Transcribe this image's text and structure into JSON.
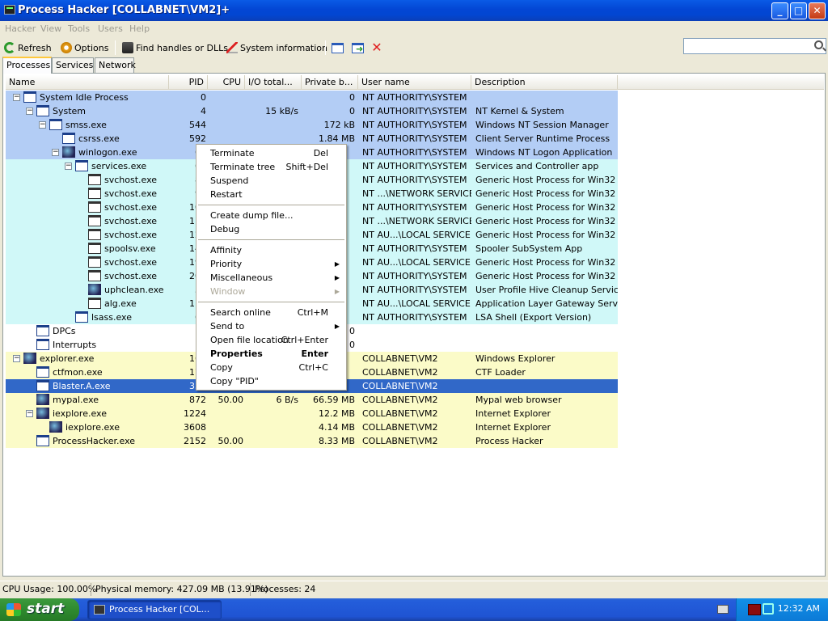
{
  "window": {
    "title": "Process Hacker [COLLABNET\\VM2]+",
    "minimize": "_",
    "maximize": "□",
    "close": "✕"
  },
  "menu": [
    "Hacker",
    "View",
    "Tools",
    "Users",
    "Help"
  ],
  "toolbar": {
    "refresh": "Refresh",
    "options": "Options",
    "find": "Find handles or DLLs",
    "sysinfo": "System information"
  },
  "tabs": [
    "Processes",
    "Services",
    "Network"
  ],
  "columns": [
    "Name",
    "PID",
    "CPU",
    "I/O total...",
    "Private b...",
    "User name",
    "Description"
  ],
  "colors": {
    "system": "#b3cdf5",
    "service": "#d0f8f8",
    "user": "#fbfbc8",
    "selected": "#3168c8",
    "none": "#ffffff"
  },
  "rows": [
    {
      "name": "System Idle Process",
      "pid": "0",
      "cpu": "",
      "io": "",
      "priv": "0",
      "user": "NT AUTHORITY\\SYSTEM",
      "desc": "",
      "depth": 0,
      "exp": "−",
      "color": "system"
    },
    {
      "name": "System",
      "pid": "4",
      "cpu": "",
      "io": "15 kB/s",
      "priv": "0",
      "user": "NT AUTHORITY\\SYSTEM",
      "desc": "NT Kernel & System",
      "depth": 1,
      "exp": "−",
      "color": "system"
    },
    {
      "name": "smss.exe",
      "pid": "544",
      "cpu": "",
      "io": "",
      "priv": "172 kB",
      "user": "NT AUTHORITY\\SYSTEM",
      "desc": "Windows NT Session Manager",
      "depth": 2,
      "exp": "−",
      "color": "system"
    },
    {
      "name": "csrss.exe",
      "pid": "592",
      "cpu": "",
      "io": "",
      "priv": "1.84 MB",
      "user": "NT AUTHORITY\\SYSTEM",
      "desc": "Client Server Runtime Process",
      "depth": 3,
      "exp": "",
      "color": "system"
    },
    {
      "name": "winlogon.exe",
      "pid": "61",
      "cpu": "",
      "io": "",
      "priv": "",
      "user": "NT AUTHORITY\\SYSTEM",
      "desc": "Windows NT Logon Application",
      "depth": 3,
      "exp": "−",
      "color": "system",
      "icon": "special"
    },
    {
      "name": "services.exe",
      "pid": "66",
      "cpu": "",
      "io": "",
      "priv": "",
      "user": "NT AUTHORITY\\SYSTEM",
      "desc": "Services and Controller app",
      "depth": 4,
      "exp": "−",
      "color": "service"
    },
    {
      "name": "svchost.exe",
      "pid": "83",
      "cpu": "",
      "io": "",
      "priv": "",
      "user": "NT AUTHORITY\\SYSTEM",
      "desc": "Generic Host Process for Win32 ...",
      "depth": 5,
      "exp": "",
      "color": "service",
      "icon": "svc"
    },
    {
      "name": "svchost.exe",
      "pid": "92",
      "cpu": "",
      "io": "",
      "priv": "",
      "user": "NT ...\\NETWORK SERVICE",
      "desc": "Generic Host Process for Win32 ...",
      "depth": 5,
      "exp": "",
      "color": "service",
      "icon": "svc"
    },
    {
      "name": "svchost.exe",
      "pid": "102",
      "cpu": "",
      "io": "",
      "priv": "",
      "user": "NT AUTHORITY\\SYSTEM",
      "desc": "Generic Host Process for Win32 ...",
      "depth": 5,
      "exp": "",
      "color": "service",
      "icon": "svc"
    },
    {
      "name": "svchost.exe",
      "pid": "118",
      "cpu": "",
      "io": "",
      "priv": "",
      "user": "NT ...\\NETWORK SERVICE",
      "desc": "Generic Host Process for Win32 ...",
      "depth": 5,
      "exp": "",
      "color": "service",
      "icon": "svc"
    },
    {
      "name": "svchost.exe",
      "pid": "127",
      "cpu": "",
      "io": "",
      "priv": "",
      "user": "NT AU...\\LOCAL SERVICE",
      "desc": "Generic Host Process for Win32 ...",
      "depth": 5,
      "exp": "",
      "color": "service",
      "icon": "svc"
    },
    {
      "name": "spoolsv.exe",
      "pid": "144",
      "cpu": "",
      "io": "",
      "priv": "",
      "user": "NT AUTHORITY\\SYSTEM",
      "desc": "Spooler SubSystem App",
      "depth": 5,
      "exp": "",
      "color": "service",
      "icon": "svc"
    },
    {
      "name": "svchost.exe",
      "pid": "194",
      "cpu": "",
      "io": "",
      "priv": "",
      "user": "NT AU...\\LOCAL SERVICE",
      "desc": "Generic Host Process for Win32 ...",
      "depth": 5,
      "exp": "",
      "color": "service",
      "icon": "svc"
    },
    {
      "name": "svchost.exe",
      "pid": "203",
      "cpu": "",
      "io": "",
      "priv": "",
      "user": "NT AUTHORITY\\SYSTEM",
      "desc": "Generic Host Process for Win32 ...",
      "depth": 5,
      "exp": "",
      "color": "service",
      "icon": "svc"
    },
    {
      "name": "uphclean.exe",
      "pid": "34",
      "cpu": "",
      "io": "",
      "priv": "",
      "user": "NT AUTHORITY\\SYSTEM",
      "desc": "User Profile Hive Cleanup Service",
      "depth": 5,
      "exp": "",
      "color": "service",
      "icon": "special"
    },
    {
      "name": "alg.exe",
      "pid": "111",
      "cpu": "",
      "io": "",
      "priv": "",
      "user": "NT AU...\\LOCAL SERVICE",
      "desc": "Application Layer Gateway Service",
      "depth": 5,
      "exp": "",
      "color": "service",
      "icon": "svc"
    },
    {
      "name": "lsass.exe",
      "pid": "67",
      "cpu": "",
      "io": "",
      "priv": "",
      "user": "NT AUTHORITY\\SYSTEM",
      "desc": "LSA Shell (Export Version)",
      "depth": 4,
      "exp": "",
      "color": "service"
    },
    {
      "name": "DPCs",
      "pid": "",
      "cpu": "",
      "io": "",
      "priv": "0",
      "user": "",
      "desc": "",
      "depth": 1,
      "exp": "",
      "color": "none"
    },
    {
      "name": "Interrupts",
      "pid": "",
      "cpu": "",
      "io": "",
      "priv": "0",
      "user": "",
      "desc": "",
      "depth": 1,
      "exp": "",
      "color": "none"
    },
    {
      "name": "explorer.exe",
      "pid": "163",
      "cpu": "",
      "io": "",
      "priv": "",
      "user": "COLLABNET\\VM2",
      "desc": "Windows Explorer",
      "depth": 0,
      "exp": "−",
      "color": "user",
      "icon": "special"
    },
    {
      "name": "ctfmon.exe",
      "pid": "178",
      "cpu": "",
      "io": "",
      "priv": "",
      "user": "COLLABNET\\VM2",
      "desc": "CTF Loader",
      "depth": 1,
      "exp": "",
      "color": "user"
    },
    {
      "name": "Blaster.A.exe",
      "pid": "357",
      "cpu": "",
      "io": "",
      "priv": "",
      "user": "COLLABNET\\VM2",
      "desc": "",
      "depth": 1,
      "exp": "",
      "color": "selected"
    },
    {
      "name": "mypal.exe",
      "pid": "872",
      "cpu": "50.00",
      "io": "6 B/s",
      "priv": "66.59 MB",
      "user": "COLLABNET\\VM2",
      "desc": "Mypal web browser",
      "depth": 1,
      "exp": "",
      "color": "user",
      "icon": "special"
    },
    {
      "name": "iexplore.exe",
      "pid": "1224",
      "cpu": "",
      "io": "",
      "priv": "12.2 MB",
      "user": "COLLABNET\\VM2",
      "desc": "Internet Explorer",
      "depth": 1,
      "exp": "−",
      "color": "user",
      "icon": "special"
    },
    {
      "name": "iexplore.exe",
      "pid": "3608",
      "cpu": "",
      "io": "",
      "priv": "4.14 MB",
      "user": "COLLABNET\\VM2",
      "desc": "Internet Explorer",
      "depth": 2,
      "exp": "",
      "color": "user",
      "icon": "special"
    },
    {
      "name": "ProcessHacker.exe",
      "pid": "2152",
      "cpu": "50.00",
      "io": "",
      "priv": "8.33 MB",
      "user": "COLLABNET\\VM2",
      "desc": "Process Hacker",
      "depth": 1,
      "exp": "",
      "color": "user"
    }
  ],
  "context_menu": [
    {
      "label": "Terminate",
      "shortcut": "Del"
    },
    {
      "label": "Terminate tree",
      "shortcut": "Shift+Del"
    },
    {
      "label": "Suspend",
      "shortcut": ""
    },
    {
      "label": "Restart",
      "shortcut": ""
    },
    {
      "sep": true
    },
    {
      "label": "Create dump file...",
      "shortcut": ""
    },
    {
      "label": "Debug",
      "shortcut": ""
    },
    {
      "sep": true
    },
    {
      "label": "Affinity",
      "shortcut": ""
    },
    {
      "label": "Priority",
      "shortcut": "",
      "submenu": true
    },
    {
      "label": "Miscellaneous",
      "shortcut": "",
      "submenu": true
    },
    {
      "label": "Window",
      "shortcut": "",
      "submenu": true,
      "disabled": true
    },
    {
      "sep": true
    },
    {
      "label": "Search online",
      "shortcut": "Ctrl+M"
    },
    {
      "label": "Send to",
      "shortcut": "",
      "submenu": true
    },
    {
      "label": "Open file location",
      "shortcut": "Ctrl+Enter"
    },
    {
      "label": "Properties",
      "shortcut": "Enter",
      "bold": true
    },
    {
      "label": "Copy",
      "shortcut": "Ctrl+C"
    },
    {
      "label": "Copy \"PID\"",
      "shortcut": ""
    }
  ],
  "status": {
    "cpu": "CPU Usage: 100.00%",
    "mem": "Physical memory: 427.09 MB (13.91%)",
    "procs": "Processes: 24"
  },
  "taskbar": {
    "start": "start",
    "task": "Process Hacker [COL...",
    "clock": "12:32 AM"
  }
}
